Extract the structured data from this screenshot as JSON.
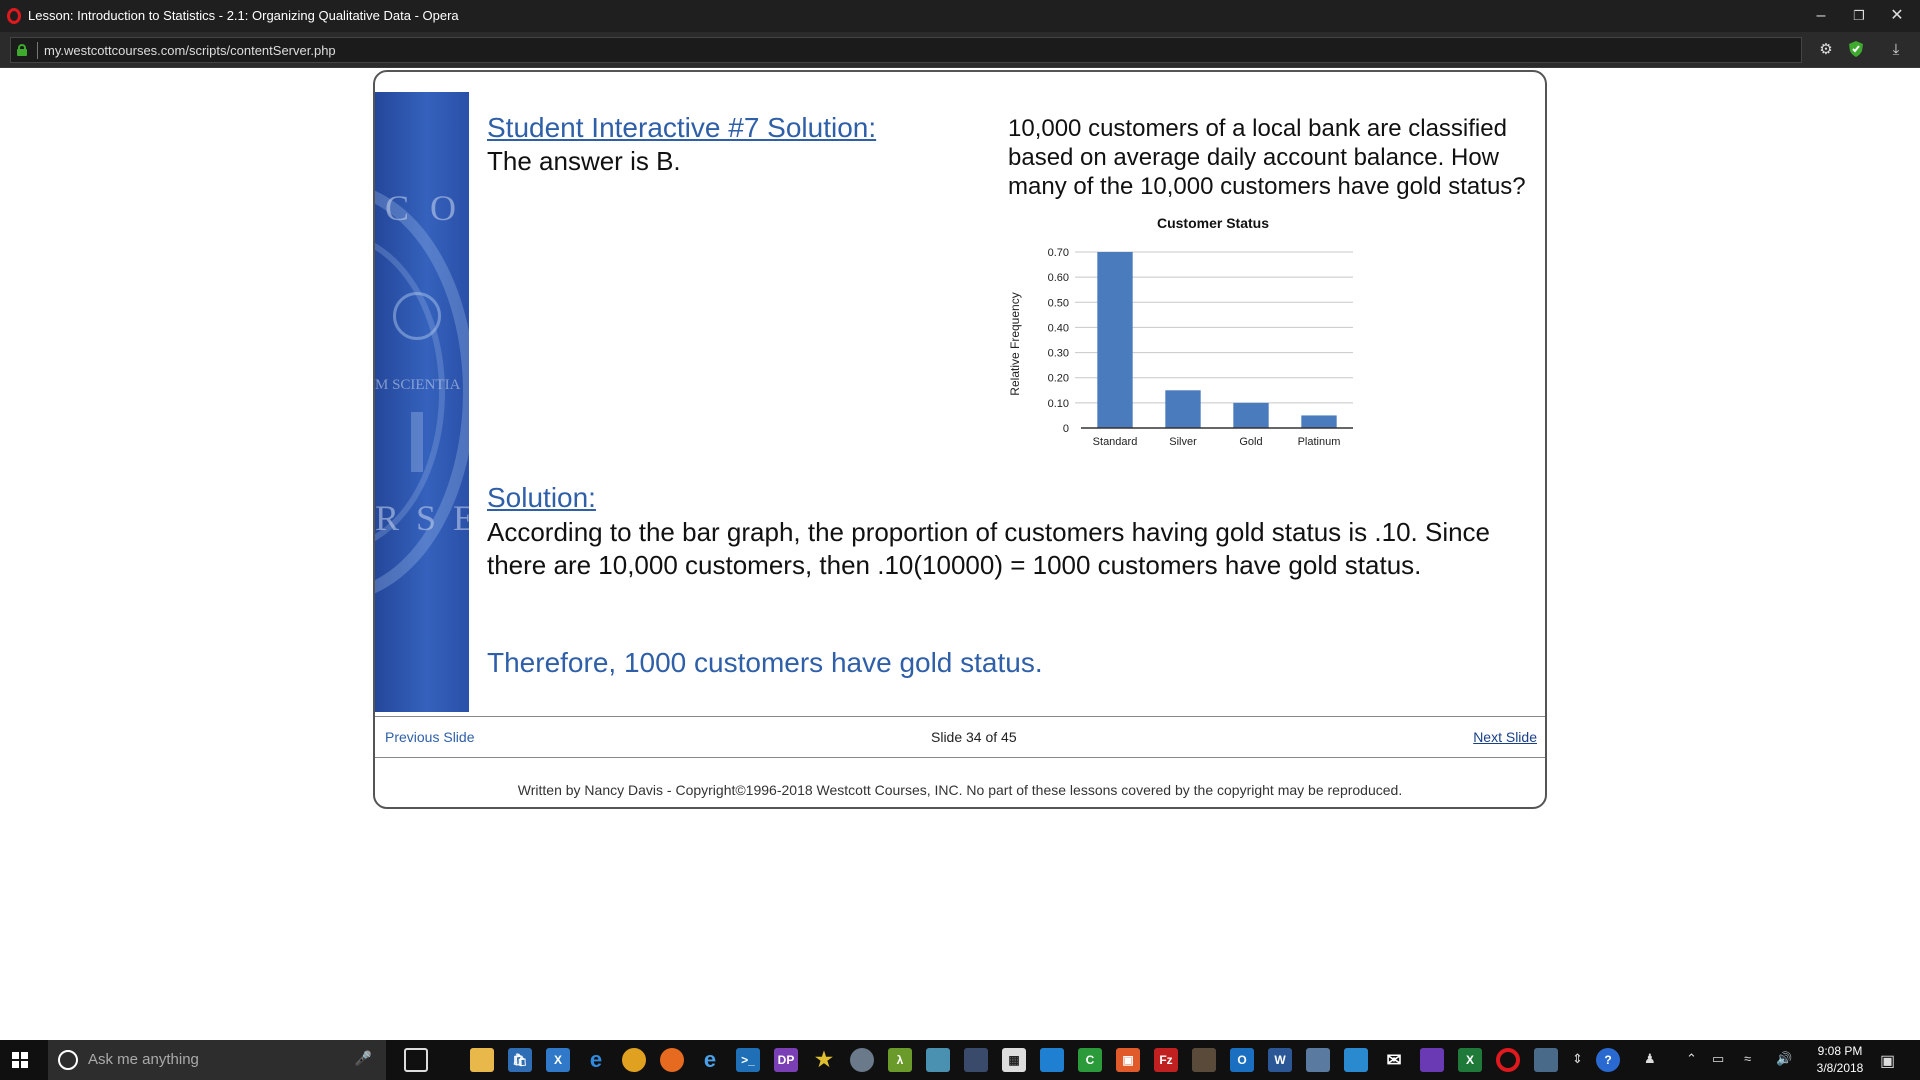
{
  "browser": {
    "title": "Lesson: Introduction to Statistics - 2.1: Organizing Qualitative Data - Opera",
    "url": "my.westcottcourses.com/scripts/contentServer.php"
  },
  "banner": {
    "seal_top": "C O",
    "seal_middle": "M SCIENTIA",
    "seal_bottom": "R S E S"
  },
  "lesson": {
    "heading": "Student Interactive #7 Solution:",
    "answer": "The answer is B.",
    "question": "10,000 customers of a local bank are classified based on average daily account balance.  How many of the 10,000 customers have gold status?",
    "solution_title": "Solution:",
    "solution_body": "According to the bar graph, the proportion of customers having gold status is .10. Since there are 10,000 customers, then .10(10000) = 1000 customers have gold status.",
    "conclusion": "Therefore, 1000 customers have gold status."
  },
  "chart_data": {
    "type": "bar",
    "title": "Customer Status",
    "xlabel": "",
    "ylabel": "Relative Frequency",
    "categories": [
      "Standard",
      "Silver",
      "Gold",
      "Platinum"
    ],
    "values": [
      0.7,
      0.15,
      0.1,
      0.05
    ],
    "ylim": [
      0,
      0.7
    ],
    "yticks": [
      "0",
      "0.10",
      "0.20",
      "0.30",
      "0.40",
      "0.50",
      "0.60",
      "0.70"
    ],
    "grid": true,
    "bar_color": "#4a7bbd"
  },
  "nav": {
    "previous": "Previous Slide",
    "slide": "Slide 34 of 45",
    "next": "Next Slide"
  },
  "footer": "Written by Nancy Davis - Copyright©1996-2018 Westcott Courses, INC. No part of these lessons covered by the copyright may be reproduced.",
  "taskbar": {
    "search_placeholder": "Ask me anything",
    "time": "9:08 PM",
    "date": "3/8/2018"
  },
  "colors": {
    "accent_link": "#2e5fa8",
    "banner_blue": "#2f5db5"
  }
}
